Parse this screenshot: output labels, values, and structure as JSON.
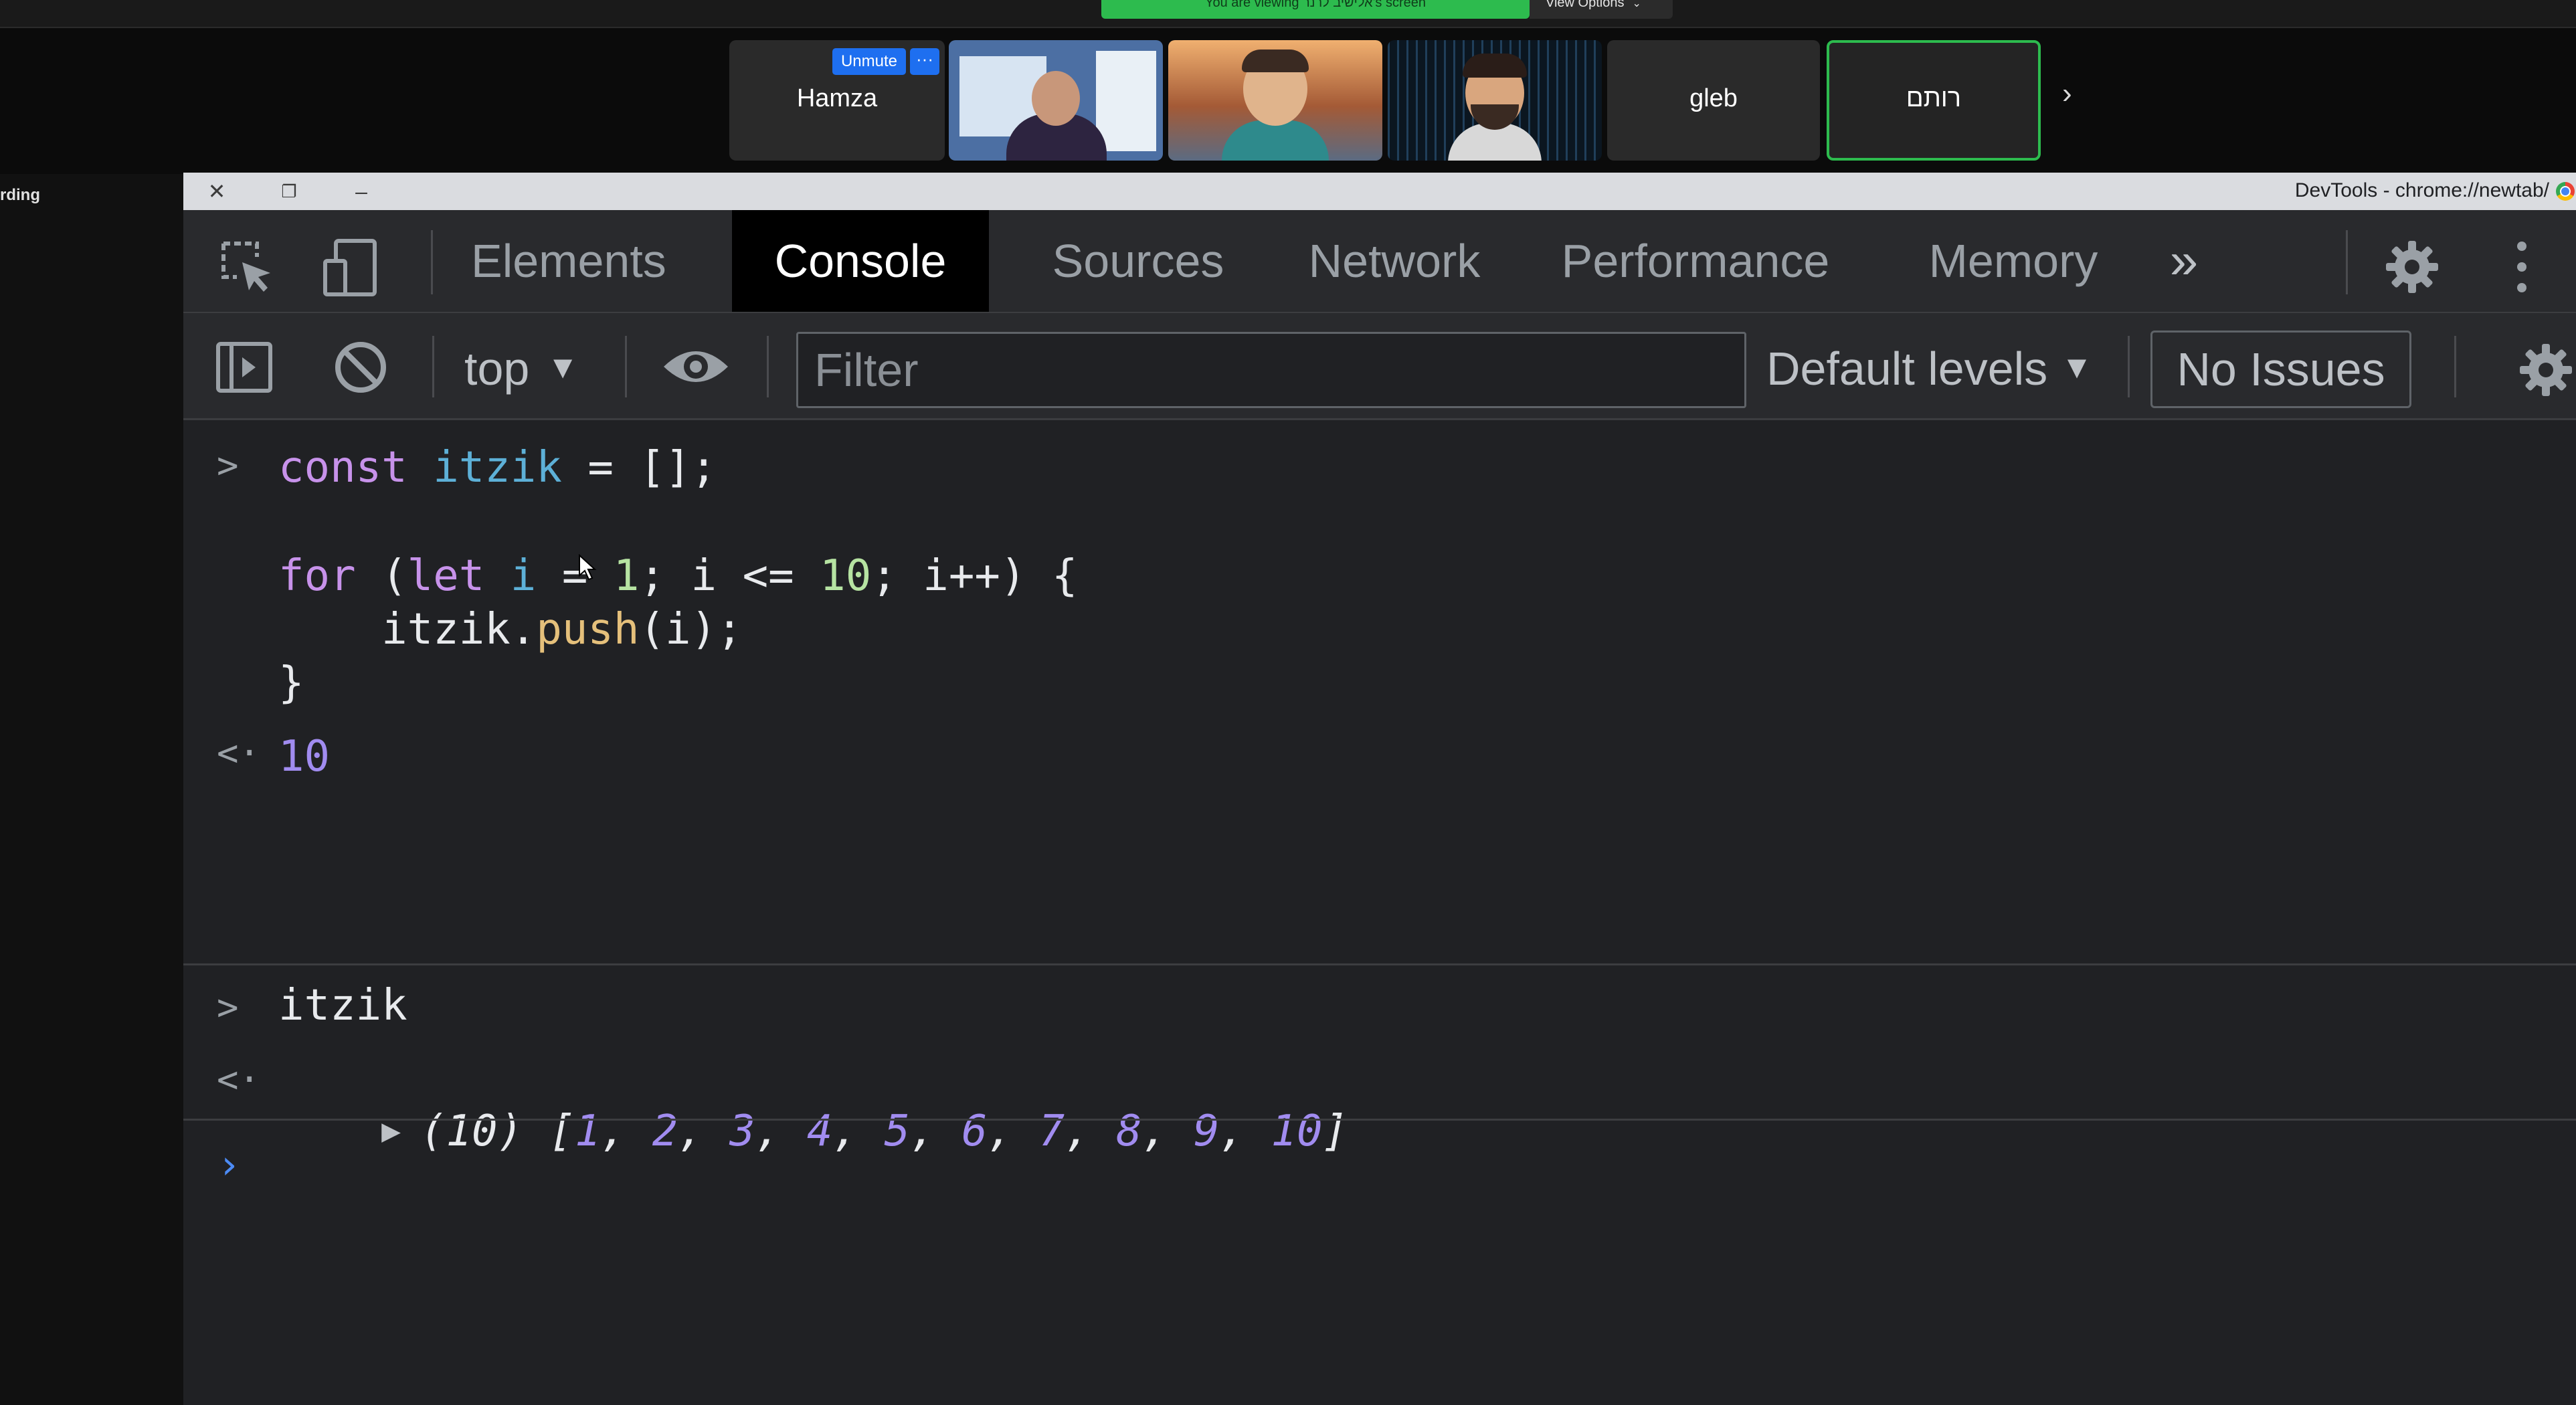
{
  "zoom": {
    "banner_text": "You are viewing אלישיב לרנר's screen",
    "view_options_label": "View Options",
    "participants": {
      "hamza": "Hamza",
      "unmute_label": "Unmute",
      "more_label": "···",
      "gleb": "gleb",
      "rotem": "רותם"
    },
    "next_arrow": "›",
    "recording_label": "rding"
  },
  "devtools": {
    "window_title": "DevTools - chrome://newtab/",
    "tabs": [
      {
        "label": "Elements"
      },
      {
        "label": "Console",
        "active": true
      },
      {
        "label": "Sources"
      },
      {
        "label": "Network"
      },
      {
        "label": "Performance"
      },
      {
        "label": "Memory"
      }
    ],
    "more_tabs": "»",
    "toolbar": {
      "context": "top",
      "filter_placeholder": "Filter",
      "levels": "Default levels",
      "issues": "No Issues"
    },
    "colors": {
      "active_tab_bg": "#000000",
      "background": "#202124",
      "keyword": "#c792ea",
      "variable": "#5db0d7",
      "number": "#b6e3a2",
      "function": "#e5c07b",
      "result": "#a18cf0",
      "prompt": "#4c8bf5"
    }
  },
  "console": {
    "input_1": {
      "kw_const": "const",
      "var_itzik": "itzik",
      "rest_1": " = [];",
      "kw_for": "for",
      "paren": " (",
      "kw_let": "let",
      "var_i": " i",
      "rest_2": " = ",
      "n1": "1",
      "rest_3": "; i <= ",
      "n10": "10",
      "rest_4": "; i++) {",
      "indent_obj": "    itzik.",
      "push": "push",
      "call": "(i);",
      "close": "}"
    },
    "output_1": "10",
    "input_2": "itzik",
    "output_2": {
      "prefix": "(10) [",
      "items": [
        "1",
        "2",
        "3",
        "4",
        "5",
        "6",
        "7",
        "8",
        "9",
        "10"
      ],
      "suffix": "]"
    },
    "prompt_symbol": "›"
  }
}
